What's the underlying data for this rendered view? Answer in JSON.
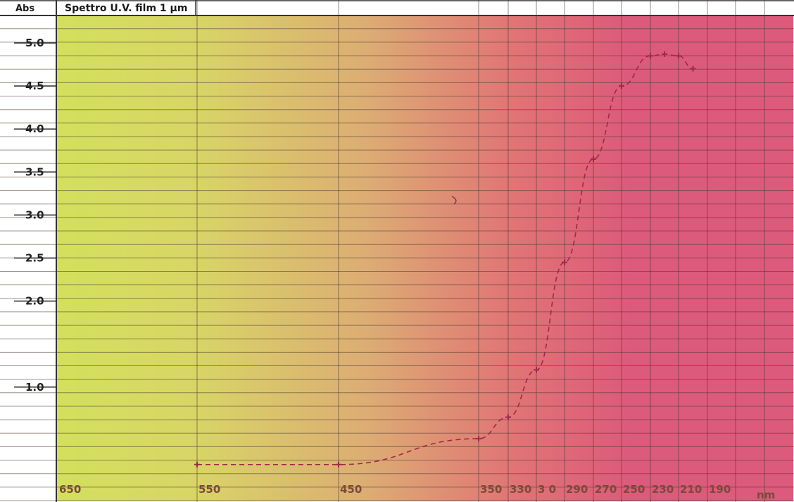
{
  "chart_data": {
    "type": "line",
    "title": "Spettro U.V. film 1 μm",
    "ylabel": "Abs",
    "xlabel": "nm",
    "x_tick_labels": [
      "650",
      "550",
      "450",
      "350",
      "330",
      "3 0",
      "290",
      "270",
      "250",
      "230",
      "210",
      "190"
    ],
    "y_tick_labels": [
      "1.0",
      "2.0",
      "2.5",
      "3.0",
      "3.5",
      "4.0",
      "4.5",
      "5.0"
    ],
    "x_ticks": [
      650,
      550,
      450,
      350,
      330,
      310,
      290,
      270,
      250,
      230,
      210,
      190
    ],
    "y_ticks": [
      1.0,
      2.0,
      2.5,
      3.0,
      3.5,
      4.0,
      4.5,
      5.0
    ],
    "ylim": [
      0.0,
      5.2
    ],
    "x_axis_note": "non-linear wavelength axis, decreasing to the right",
    "grid": true,
    "background": "gradient yellow-green (visible) to magenta (UV)",
    "series": [
      {
        "line_style": "dashed",
        "color": "#a0284a",
        "x": [
          550,
          450,
          350,
          330,
          310,
          290,
          270,
          250,
          230,
          220,
          210,
          200
        ],
        "y": [
          0.1,
          0.1,
          0.4,
          0.65,
          1.2,
          2.45,
          3.65,
          4.5,
          4.85,
          4.87,
          4.85,
          4.7
        ]
      }
    ]
  }
}
